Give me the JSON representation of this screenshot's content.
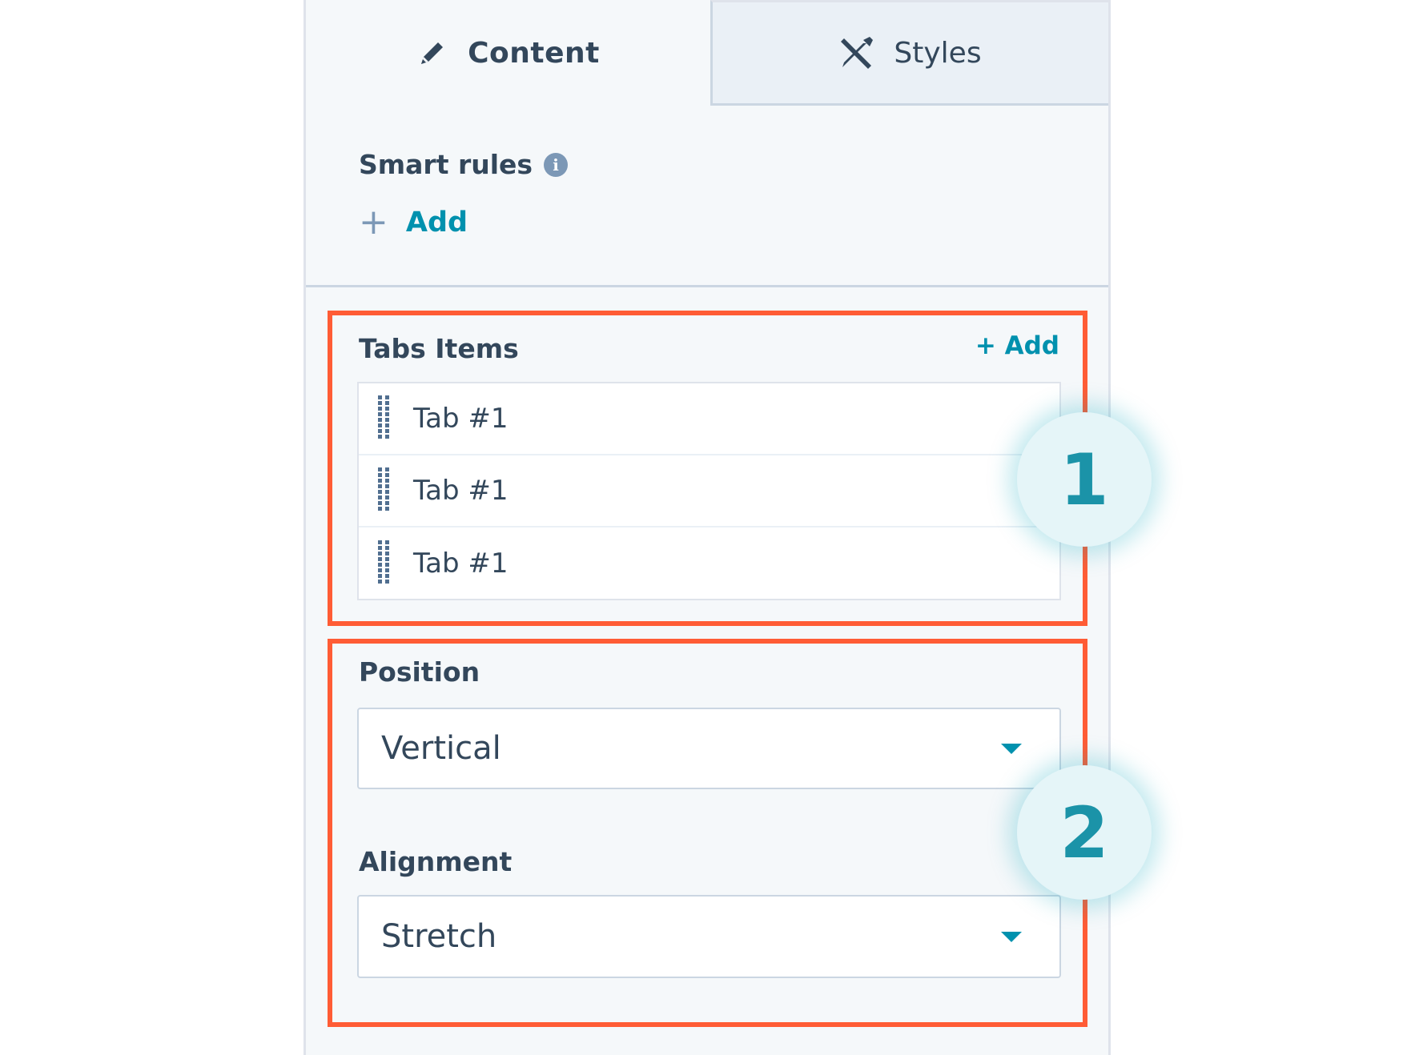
{
  "tabs": [
    {
      "label": "Content",
      "icon": "pencil-icon",
      "active": true
    },
    {
      "label": "Styles",
      "icon": "brush-icon",
      "active": false
    }
  ],
  "smart_rules": {
    "label": "Smart rules",
    "info_icon": "info-icon",
    "add_label": "Add"
  },
  "tabs_items": {
    "label": "Tabs Items",
    "add_label": "+ Add",
    "items": [
      "Tab #1",
      "Tab #1",
      "Tab #1"
    ]
  },
  "position": {
    "label": "Position",
    "value": "Vertical"
  },
  "alignment": {
    "label": "Alignment",
    "value": "Stretch"
  },
  "badges": [
    "1",
    "2"
  ],
  "colors": {
    "highlight": "#ff5c35",
    "accent": "#0091ae",
    "badge_text": "#1b93a8",
    "text": "#33475b"
  }
}
